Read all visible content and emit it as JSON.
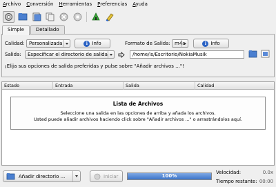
{
  "menubar": {
    "items": [
      "Archivo",
      "Conversión",
      "Herramientas",
      "Preferencias",
      "Ayuda"
    ]
  },
  "toolbar": {
    "icons": [
      "settings-icon",
      "open-folder-icon",
      "add-files-icon",
      "copy-icon",
      "cancel-icon",
      "stop-icon",
      "plugin-icon",
      "clean-icon"
    ]
  },
  "tabs": [
    {
      "label": "Simple",
      "active": true
    },
    {
      "label": "Detallado",
      "active": false
    }
  ],
  "options": {
    "quality_label": "Calidad:",
    "quality_value": "Personalizada",
    "info_label": "Info",
    "format_label": "Formato de Salida:",
    "format_value": "m4a",
    "format_info_label": "Info",
    "output_label": "Salida:",
    "output_value": "Especificar el directorio de salida",
    "output_path": "/home/is/Escritorio/NokiaMusik",
    "hint": "¡Elija sus opciones de salida preferidas y pulse sobre \"Añadir archivos ...\"!"
  },
  "file_list": {
    "columns": [
      "Estado",
      "Entrada",
      "Salida",
      "Calidad"
    ],
    "empty_title": "Lista de Archivos",
    "empty_line1": "Seleccione una salida en las opciones de arriba y añada los archivos.",
    "empty_line2": "Usted puede añadir archivos haciendo click sobre \"Añadir archivos ...\" o arrastrándolos aquí."
  },
  "bottom": {
    "add_dir_label": "Añadir directorio ...",
    "start_label": "Iniciar",
    "progress_text": "100%",
    "progress_value": 1.0,
    "speed_label": "Velocidad:",
    "speed_value": "0.0x",
    "time_label": "Tiempo restante:",
    "time_value": "00:00"
  },
  "colors": {
    "accent": "#3b74c9",
    "info": "#2a62c4"
  }
}
